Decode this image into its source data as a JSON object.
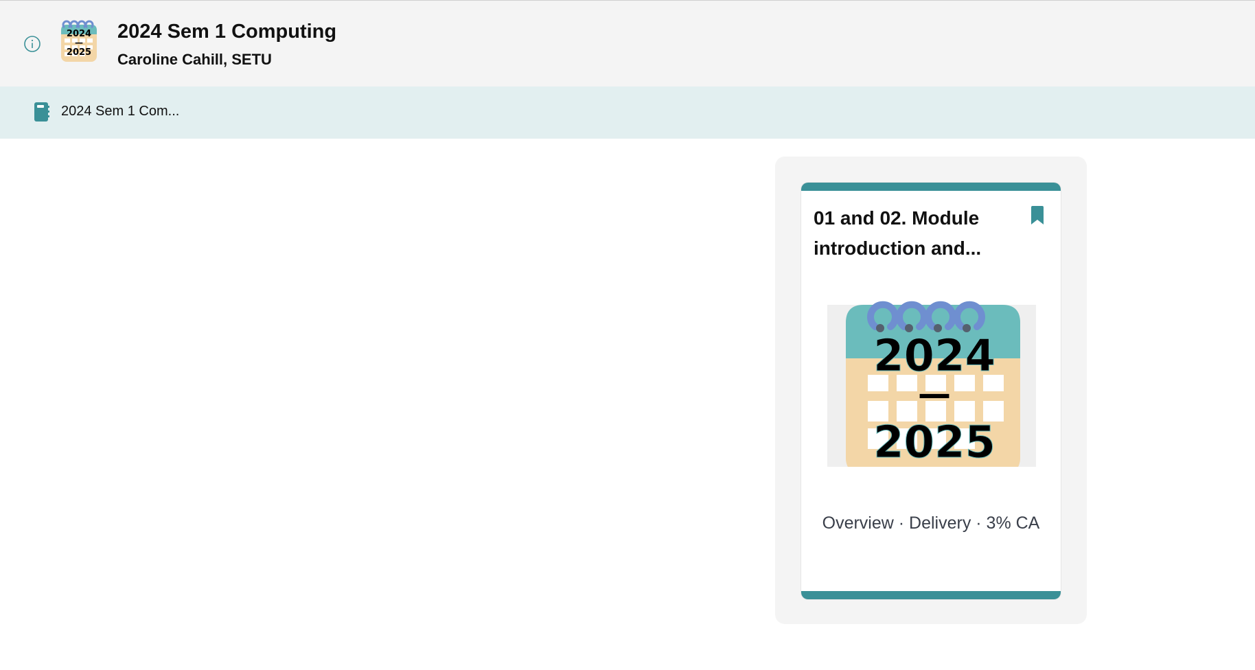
{
  "header": {
    "title": "2024 Sem 1 Computing",
    "subtitle": "Caroline Cahill, SETU",
    "info_icon": "info-icon",
    "thumbnail_icon": "calendar-2024-2025-icon"
  },
  "breadcrumb": {
    "icon": "notebook-icon",
    "label": "2024 Sem 1 Com..."
  },
  "card": {
    "title": "01 and 02. Module introduction and...",
    "bookmark_icon": "bookmark-icon",
    "image_icon": "calendar-2024-2025-icon",
    "description": "Overview · Delivery · 3% CA",
    "calendar_year_top": "2024",
    "calendar_dash": "—",
    "calendar_year_bottom": "2025"
  },
  "colors": {
    "accent": "#3a9097",
    "header_bg": "#f4f4f4",
    "breadcrumb_bg": "#e2eff0",
    "calendar_teal": "#6bbcbc",
    "calendar_peach": "#f3d6a7",
    "calendar_rings": "#6f8fd0"
  }
}
